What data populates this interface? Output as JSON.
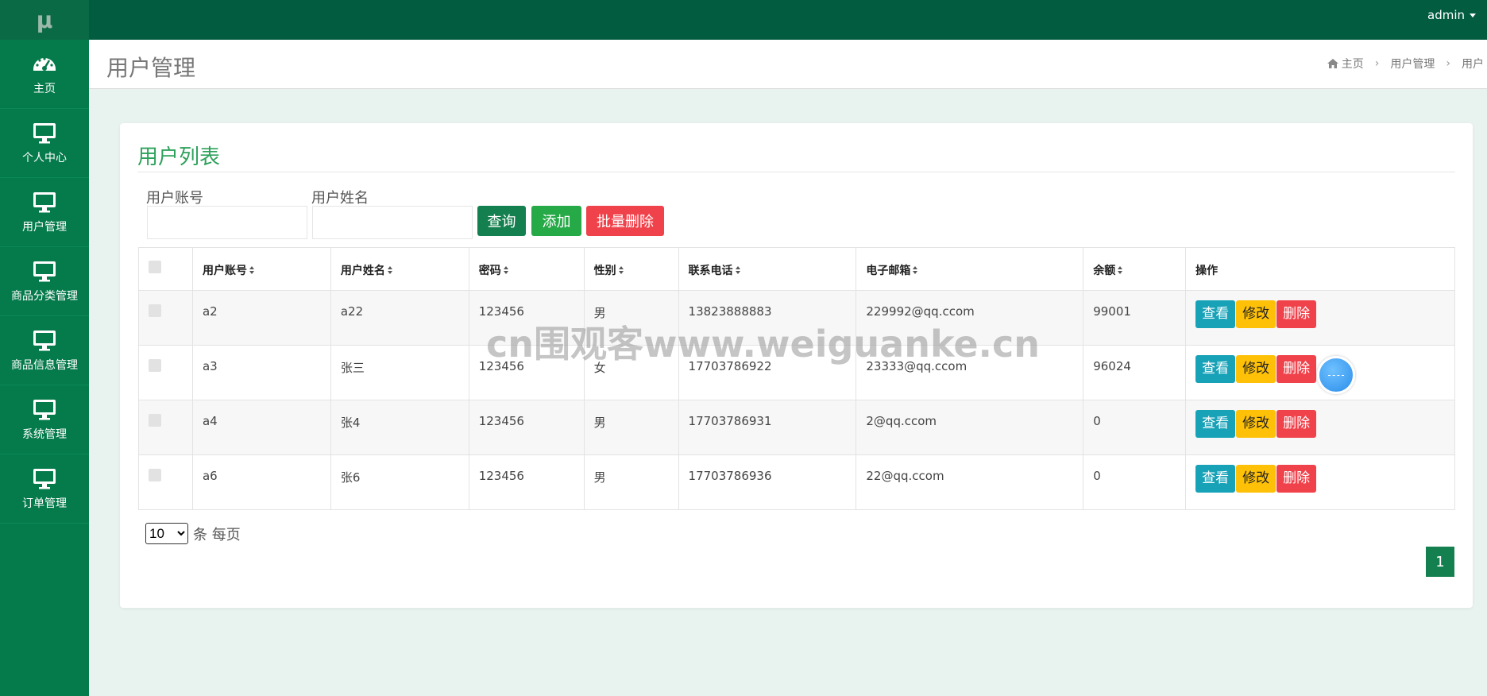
{
  "app": {
    "logo": "μ",
    "user": "admin"
  },
  "sidebar": {
    "items": [
      {
        "label": "主页",
        "icon": "dashboard-icon"
      },
      {
        "label": "个人中心",
        "icon": "monitor-icon"
      },
      {
        "label": "用户管理",
        "icon": "monitor-icon"
      },
      {
        "label": "商品分类管理",
        "icon": "monitor-icon"
      },
      {
        "label": "商品信息管理",
        "icon": "monitor-icon"
      },
      {
        "label": "系统管理",
        "icon": "monitor-icon"
      },
      {
        "label": "订单管理",
        "icon": "monitor-icon"
      }
    ]
  },
  "header": {
    "title": "用户管理",
    "breadcrumb": [
      "主页",
      "用户管理",
      "用户"
    ]
  },
  "card": {
    "title": "用户列表"
  },
  "search": {
    "account_label": "用户账号",
    "name_label": "用户姓名",
    "query": "查询",
    "add": "添加",
    "batch_delete": "批量删除"
  },
  "table": {
    "headers": [
      "用户账号",
      "用户姓名",
      "密码",
      "性别",
      "联系电话",
      "电子邮箱",
      "余额",
      "操作"
    ],
    "rows": [
      {
        "account": "a2",
        "name": "a22",
        "password": "123456",
        "gender": "男",
        "phone": "13823888883",
        "email": "229992@qq.ccom",
        "balance": "99001"
      },
      {
        "account": "a3",
        "name": "张三",
        "password": "123456",
        "gender": "女",
        "phone": "17703786922",
        "email": "23333@qq.ccom",
        "balance": "96024"
      },
      {
        "account": "a4",
        "name": "张4",
        "password": "123456",
        "gender": "男",
        "phone": "17703786931",
        "email": "2@qq.ccom",
        "balance": "0"
      },
      {
        "account": "a6",
        "name": "张6",
        "password": "123456",
        "gender": "男",
        "phone": "17703786936",
        "email": "22@qq.ccom",
        "balance": "0"
      }
    ],
    "actions": {
      "view": "查看",
      "edit": "修改",
      "delete": "删除"
    }
  },
  "pagination": {
    "page_size": "10",
    "page_size_label": "条 每页",
    "current_page": "1"
  },
  "watermark": "cn围观客www.weiguanke.cn",
  "colors": {
    "sidebar": "#057a4b",
    "topbar": "#025c3f",
    "accent": "#15804f"
  }
}
